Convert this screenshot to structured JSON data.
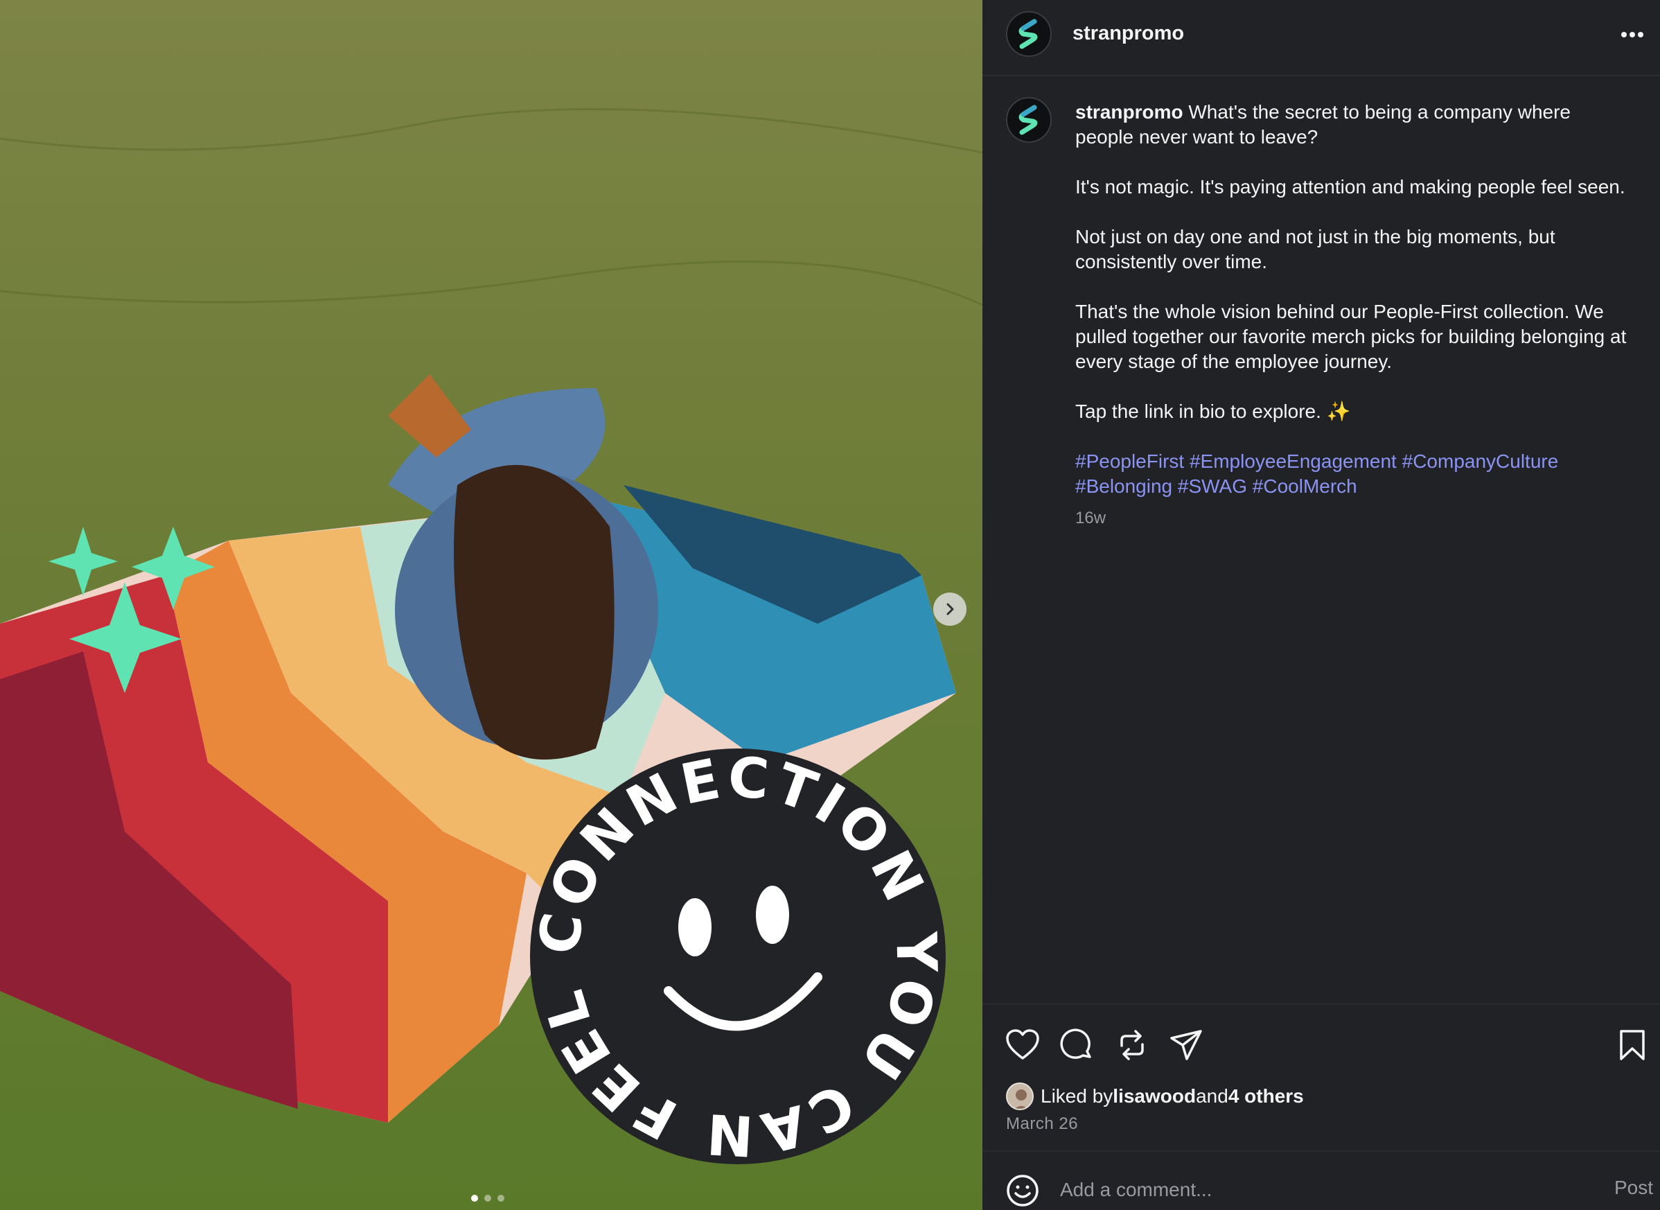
{
  "post": {
    "username": "stranpromo",
    "more_icon": "more-horizontal-icon",
    "image": {
      "badge_text": "CONNECTION YOU CAN FEEL",
      "carousel_count": 3,
      "carousel_active": 1,
      "accent_color": "#5fe3b3"
    }
  },
  "caption": {
    "username": "stranpromo",
    "intro": " What's the secret to being a company where people never want to leave?",
    "p2": "It's not magic. It's paying attention and making people feel seen.",
    "p3": "Not just on day one and not just in the big moments, but consistently over time.",
    "p4": "That's the whole vision behind our People-First collection. We pulled together our favorite merch picks for building belonging at every stage of the employee journey.",
    "p5": "Tap the link in bio to explore. ✨",
    "hashtags": [
      "#PeopleFirst",
      "#EmployeeEngagement",
      "#CompanyCulture",
      "#Belonging",
      "#SWAG",
      "#CoolMerch"
    ],
    "age": "16w"
  },
  "actions": {
    "liked_by_prefix": "Liked by ",
    "liked_by_user": "lisawood",
    "and": " and ",
    "others": "4 others",
    "date": "March 26"
  },
  "comment": {
    "placeholder": "Add a comment...",
    "post_label": "Post"
  },
  "colors": {
    "panel_bg": "#212226",
    "hashtag": "#8b93f3",
    "muted": "#9a9ba0"
  }
}
